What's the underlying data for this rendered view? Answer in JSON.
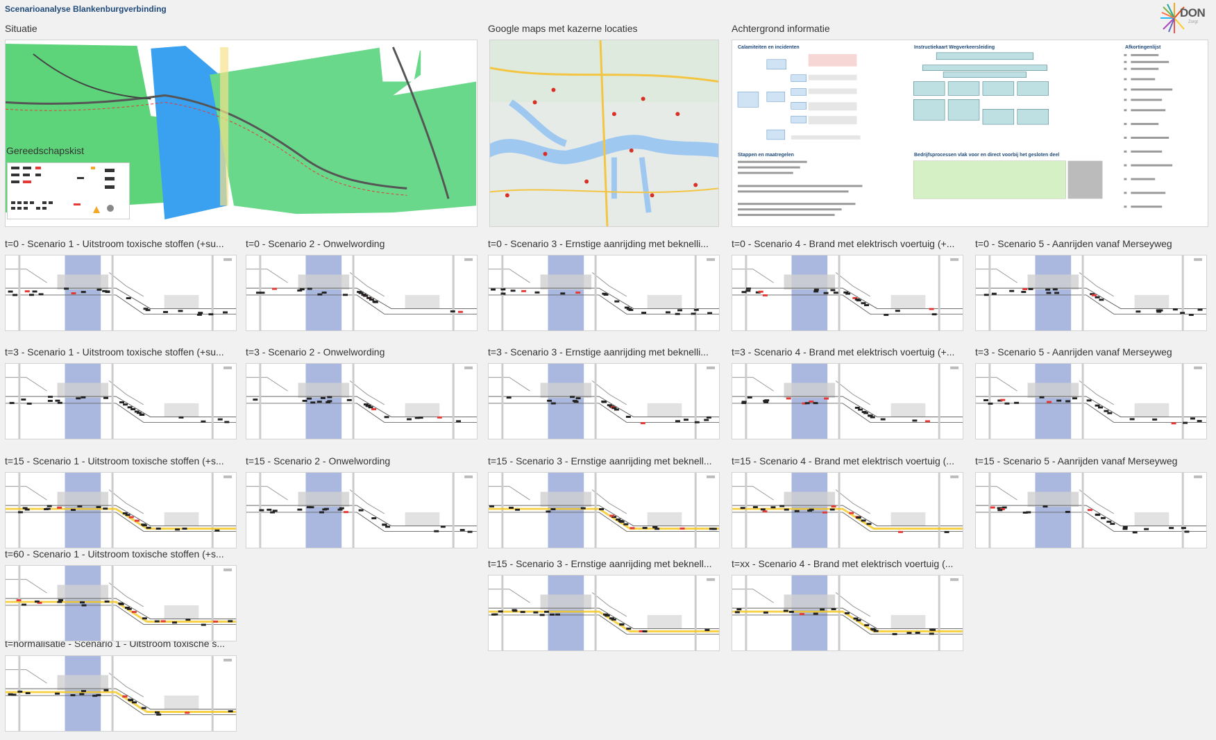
{
  "board": {
    "title": "Scenarioanalyse Blankenburgverbinding",
    "logo_text": "DON",
    "logo_sub": "Zorgt"
  },
  "frames": {
    "situatie": "Situatie",
    "gereedschapskist": "Gereedschapskist",
    "google_maps": "Google maps met kazerne locaties",
    "achtergrond": "Achtergrond informatie"
  },
  "background_doc": {
    "calamiteiten": "Calamiteiten en incidenten",
    "instructiekaart": "Instructiekaart Wegverkeersleiding",
    "afkortingen": "Afkortingenlijst",
    "stappen": "Stappen en maatregelen",
    "bedrijfsprocessen": "Bedrijfsprocessen vlak voor en direct voorbij het gesloten deel"
  },
  "scenarios": {
    "r1": [
      "t=0 - Scenario 1 - Uitstroom toxische stoffen (+su...",
      "t=0 - Scenario 2 - Onwelwording",
      "t=0 - Scenario 3 - Ernstige aanrijding met beknelli...",
      "t=0 - Scenario 4 - Brand met elektrisch voertuig (+...",
      "t=0 - Scenario 5 - Aanrijden vanaf Merseyweg"
    ],
    "r2": [
      "t=3 - Scenario 1 - Uitstroom toxische stoffen (+su...",
      "t=3 - Scenario 2 - Onwelwording",
      "t=3 - Scenario 3 - Ernstige aanrijding met beknelli...",
      "t=3 - Scenario 4 - Brand met elektrisch voertuig (+...",
      "t=3 - Scenario 5 - Aanrijden vanaf Merseyweg"
    ],
    "r3": [
      "t=15 - Scenario 1 - Uitstroom toxische stoffen (+s...",
      "t=15 - Scenario 2 - Onwelwording",
      "t=15 - Scenario 3 - Ernstige aanrijding met beknell...",
      "t=15 - Scenario 4 - Brand met elektrisch voertuig (...",
      "t=15 - Scenario 5 - Aanrijden vanaf Merseyweg"
    ],
    "r4": [
      "t=60 - Scenario 1 - Uitstroom toxische stoffen (+s...",
      "t=15 - Scenario 3 - Ernstige aanrijding met beknell...",
      "t=xx - Scenario 4 - Brand met elektrisch voertuig (..."
    ],
    "r5": [
      "t=normalisatie - Scenario 1 - Uitstroom toxische s..."
    ]
  },
  "colors": {
    "water": "#2196f3",
    "land": "#5ed47a",
    "tunnel_band": "#aab8e0",
    "map_bg": "#e6ebe8",
    "accent_title": "#1f4a7a"
  }
}
